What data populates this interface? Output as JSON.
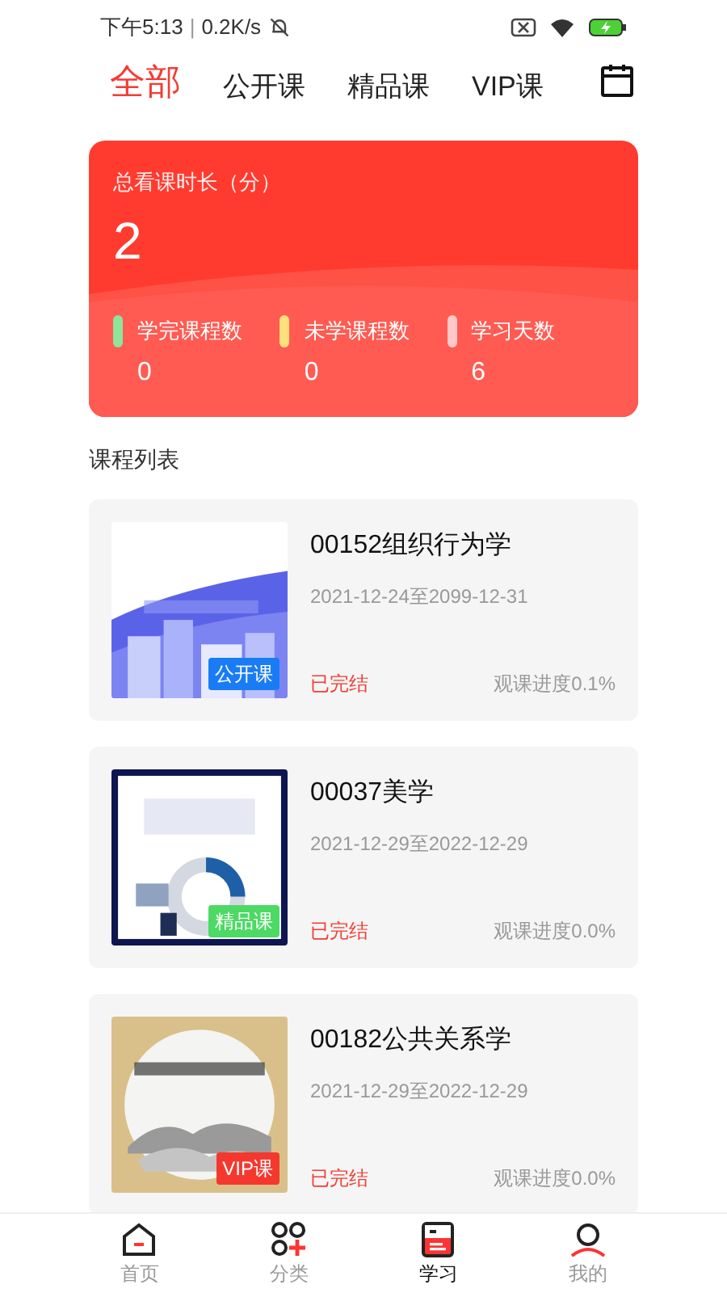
{
  "status_bar": {
    "time": "下午5:13",
    "separator": "|",
    "speed": "0.2K/s"
  },
  "tabs": [
    {
      "label": "全部",
      "selected": true
    },
    {
      "label": "公开课",
      "selected": false
    },
    {
      "label": "精品课",
      "selected": false
    },
    {
      "label": "VIP课",
      "selected": false
    }
  ],
  "summary": {
    "title": "总看课时长（分）",
    "value": "2",
    "stats": [
      {
        "label": "学完课程数",
        "value": "0",
        "color": "#8fe39a"
      },
      {
        "label": "未学课程数",
        "value": "0",
        "color": "#ffe07a"
      },
      {
        "label": "学习天数",
        "value": "6",
        "color": "#ffc9c9"
      }
    ]
  },
  "section_title": "课程列表",
  "courses": [
    {
      "kind": "picture",
      "title": "00152组织行为学",
      "dates": "2021-12-24至2099-12-31",
      "badge": "公开课",
      "color": "#1a7cf5",
      "status": "已完结",
      "watched": "观课进度0.1%"
    },
    {
      "kind": "picture",
      "title": "00037美学",
      "dates": "2021-12-29至2022-12-29",
      "badge": "精品课",
      "color": "#4cd964",
      "status": "已完结",
      "watched": "观课进度0.0%"
    },
    {
      "kind": "picture",
      "title": "00182公共关系学",
      "dates": "2021-12-29至2022-12-29",
      "badge": "VIP课",
      "color": "#f5382e",
      "status": "已完结",
      "watched": "观课进度0.0%"
    }
  ],
  "nav": [
    {
      "label": "首页",
      "selected": false
    },
    {
      "label": "分类",
      "selected": false
    },
    {
      "label": "学习",
      "selected": true
    },
    {
      "label": "我的",
      "selected": false
    }
  ]
}
